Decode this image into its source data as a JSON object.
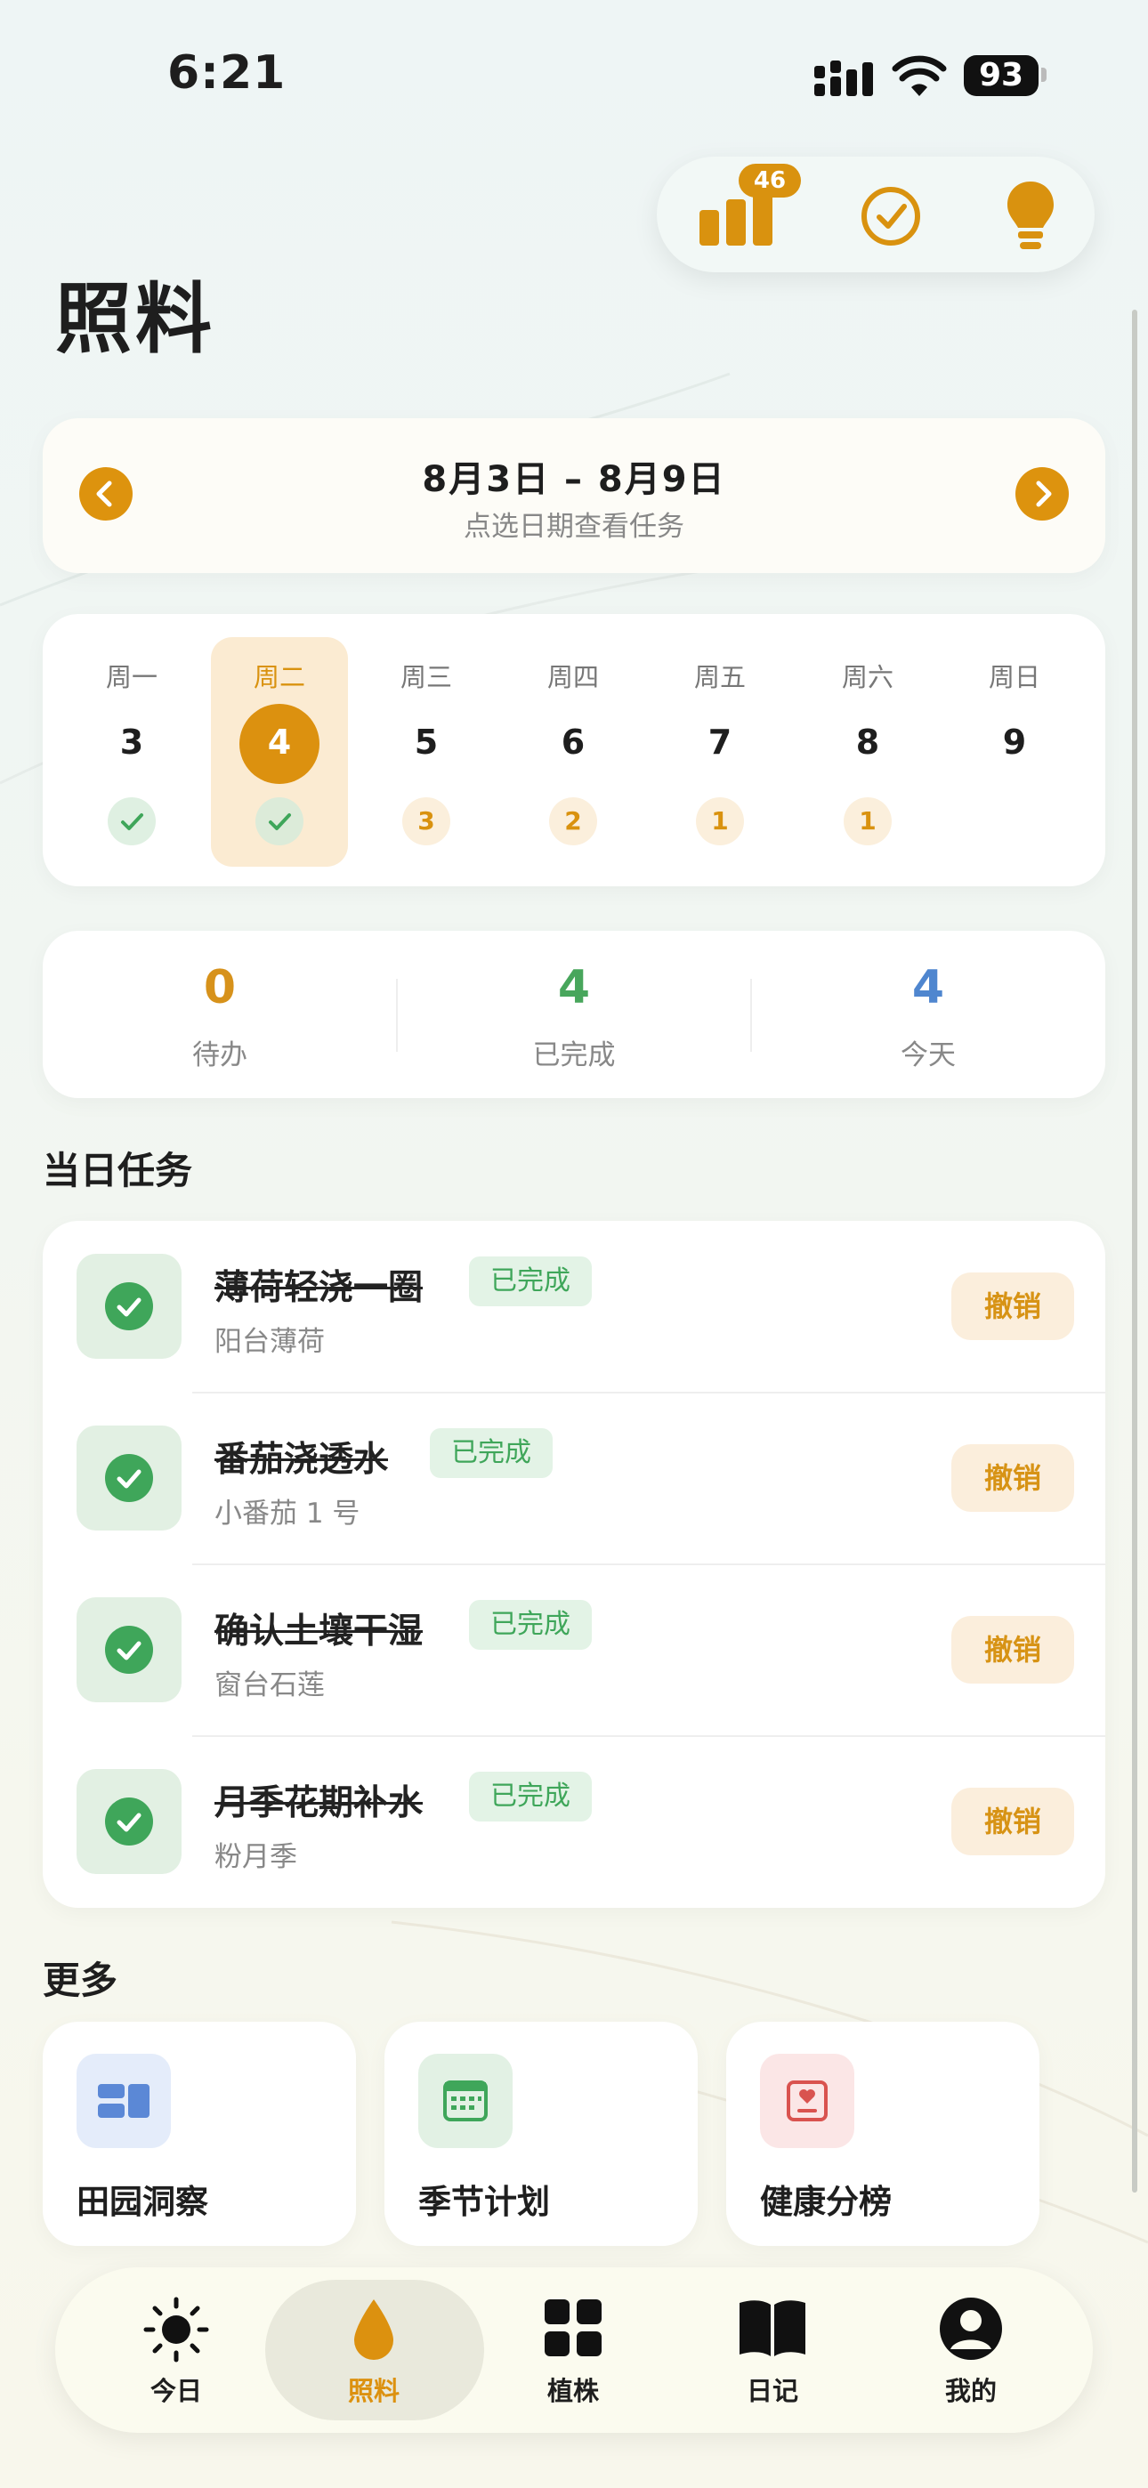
{
  "status_bar": {
    "time": "6:21",
    "battery": "93"
  },
  "top_actions": {
    "badge_count": "46"
  },
  "page_title": "照料",
  "week": {
    "range": "8月3日 – 8月9日",
    "hint": "点选日期查看任务",
    "days": [
      {
        "name": "周一",
        "num": "3",
        "status": "done",
        "count": ""
      },
      {
        "name": "周二",
        "num": "4",
        "status": "done",
        "count": "",
        "selected": true
      },
      {
        "name": "周三",
        "num": "5",
        "status": "pending",
        "count": "3"
      },
      {
        "name": "周四",
        "num": "6",
        "status": "pending",
        "count": "2"
      },
      {
        "name": "周五",
        "num": "7",
        "status": "pending",
        "count": "1"
      },
      {
        "name": "周六",
        "num": "8",
        "status": "pending",
        "count": "1"
      },
      {
        "name": "周日",
        "num": "9",
        "status": "none",
        "count": ""
      }
    ]
  },
  "stats": [
    {
      "value": "0",
      "label": "待办",
      "color": "#d7921b"
    },
    {
      "value": "4",
      "label": "已完成",
      "color": "#48a65c"
    },
    {
      "value": "4",
      "label": "今天",
      "color": "#4f86cf"
    }
  ],
  "tasks_section": {
    "title": "当日任务",
    "items": [
      {
        "name": "薄荷轻浇一圈",
        "plant": "阳台薄荷",
        "badge": "已完成",
        "action": "撤销"
      },
      {
        "name": "番茄浇透水",
        "plant": "小番茄 1 号",
        "badge": "已完成",
        "action": "撤销"
      },
      {
        "name": "确认土壤干湿",
        "plant": "窗台石莲",
        "badge": "已完成",
        "action": "撤销"
      },
      {
        "name": "月季花期补水",
        "plant": "粉月季",
        "badge": "已完成",
        "action": "撤销"
      }
    ]
  },
  "more_section": {
    "title": "更多",
    "items": [
      {
        "label": "田园洞察",
        "icon": "dashboard-icon"
      },
      {
        "label": "季节计划",
        "icon": "calendar-icon"
      },
      {
        "label": "健康分榜",
        "icon": "heart-board-icon"
      }
    ]
  },
  "tab_bar": [
    {
      "label": "今日",
      "icon": "sun-icon"
    },
    {
      "label": "照料",
      "icon": "drop-icon",
      "selected": true
    },
    {
      "label": "植株",
      "icon": "grid-icon"
    },
    {
      "label": "日记",
      "icon": "book-icon"
    },
    {
      "label": "我的",
      "icon": "person-icon"
    }
  ],
  "colors": {
    "accent": "#dc910f",
    "success": "#3fa65a",
    "info": "#4f86cf"
  }
}
